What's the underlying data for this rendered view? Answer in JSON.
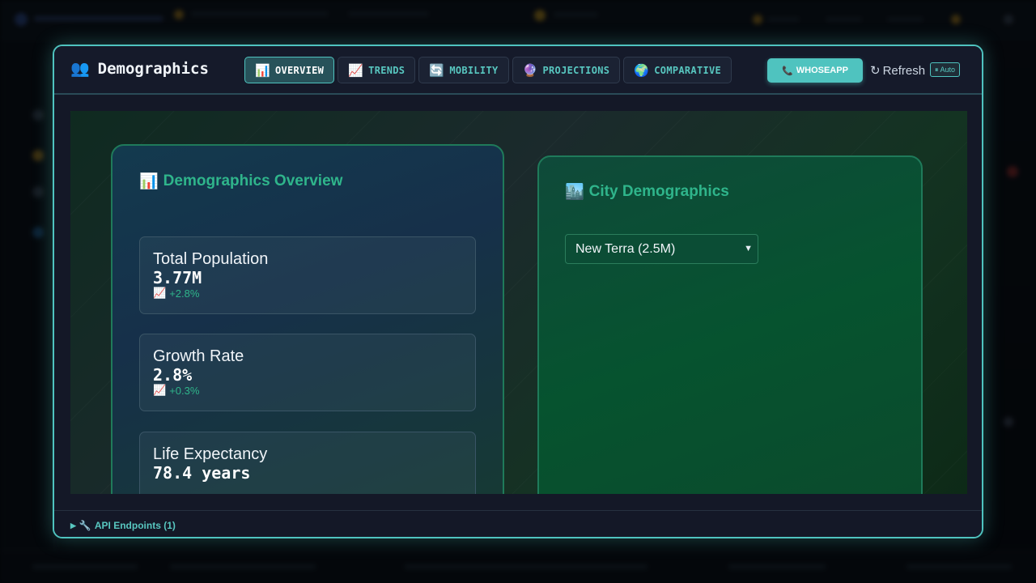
{
  "modal": {
    "title": "Demographics",
    "title_icon": "people-icon",
    "tabs": [
      {
        "label": "OVERVIEW",
        "icon": "bar-chart-icon",
        "active": true
      },
      {
        "label": "TRENDS",
        "icon": "trend-up-icon",
        "active": false
      },
      {
        "label": "MOBILITY",
        "icon": "cycle-arrows-icon",
        "active": false
      },
      {
        "label": "PROJECTIONS",
        "icon": "crystal-ball-icon",
        "active": false
      },
      {
        "label": "COMPARATIVE",
        "icon": "globe-icon",
        "active": false
      }
    ],
    "whoseapp_button": "WHOSEAPP",
    "refresh_label": "Refresh",
    "auto_badge": "Auto",
    "accent_color": "#4fc3bf"
  },
  "overview": {
    "title": "Demographics Overview",
    "title_icon": "bar-chart-icon",
    "stats": [
      {
        "label": "Total Population",
        "value": "3.77M",
        "change": "+2.8%"
      },
      {
        "label": "Growth Rate",
        "value": "2.8%",
        "change": "+0.3%"
      },
      {
        "label": "Life Expectancy",
        "value": "78.4 years",
        "change": ""
      }
    ]
  },
  "city": {
    "title": "City Demographics",
    "title_icon": "cityscape-icon",
    "selected": "New Terra (2.5M)"
  },
  "footer": {
    "api_endpoints": "API Endpoints (1)"
  }
}
